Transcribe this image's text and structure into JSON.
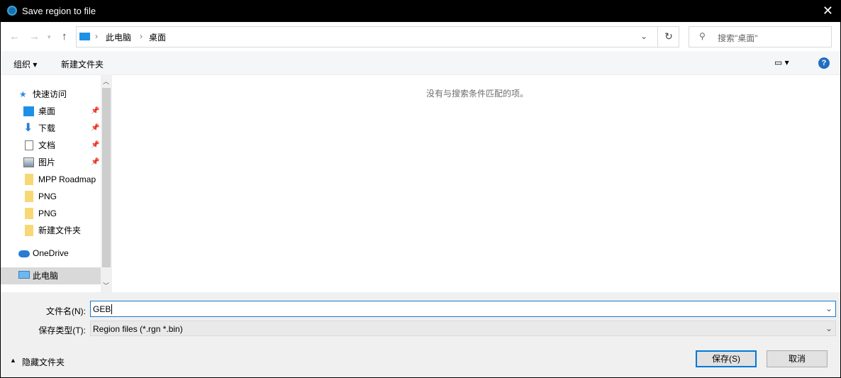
{
  "title": "Save region to file",
  "address": {
    "crumbs": [
      "此电脑",
      "桌面"
    ]
  },
  "search": {
    "placeholder": "搜索\"桌面\""
  },
  "toolbar": {
    "organize": "组织 ▾",
    "new_folder": "新建文件夹",
    "help": "?"
  },
  "sidebar": {
    "quick_access": "快速访问",
    "items": [
      {
        "label": "桌面",
        "pinned": true
      },
      {
        "label": "下载",
        "pinned": true
      },
      {
        "label": "文档",
        "pinned": true
      },
      {
        "label": "图片",
        "pinned": true
      },
      {
        "label": "MPP Roadmap"
      },
      {
        "label": "PNG"
      },
      {
        "label": "PNG"
      },
      {
        "label": "新建文件夹"
      }
    ],
    "onedrive": "OneDrive",
    "this_pc": "此电脑"
  },
  "main": {
    "empty_message": "没有与搜索条件匹配的项。"
  },
  "form": {
    "filename_label": "文件名(N):",
    "filename_value": "GEB",
    "type_label": "保存类型(T):",
    "type_value": "Region files (*.rgn *.bin)"
  },
  "footer": {
    "hide_folders": "隐藏文件夹",
    "save": "保存(S)",
    "cancel": "取消"
  }
}
